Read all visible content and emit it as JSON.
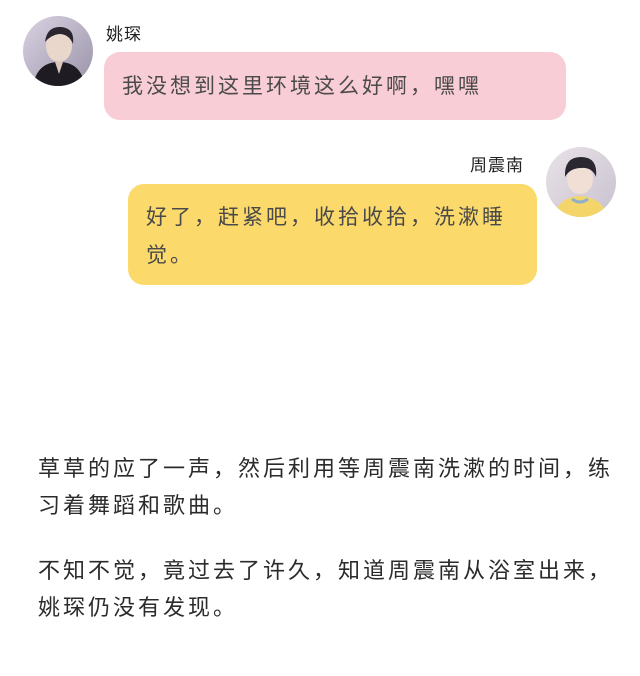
{
  "chat": {
    "messages": [
      {
        "sender": "姚琛",
        "side": "left",
        "text": "我没想到这里环境这么好啊，嘿嘿",
        "bubble_color": "#f8cdd6"
      },
      {
        "sender": "周震南",
        "side": "right",
        "text": "好了，赶紧吧，收拾收拾，洗漱睡觉。",
        "bubble_color": "#fbd96b"
      }
    ]
  },
  "narrative": {
    "paragraphs": [
      "草草的应了一声，然后利用等周震南洗漱的时间，练习着舞蹈和歌曲。",
      "不知不觉，竟过去了许久，知道周震南从浴室出来，姚琛仍没有发现。"
    ]
  }
}
